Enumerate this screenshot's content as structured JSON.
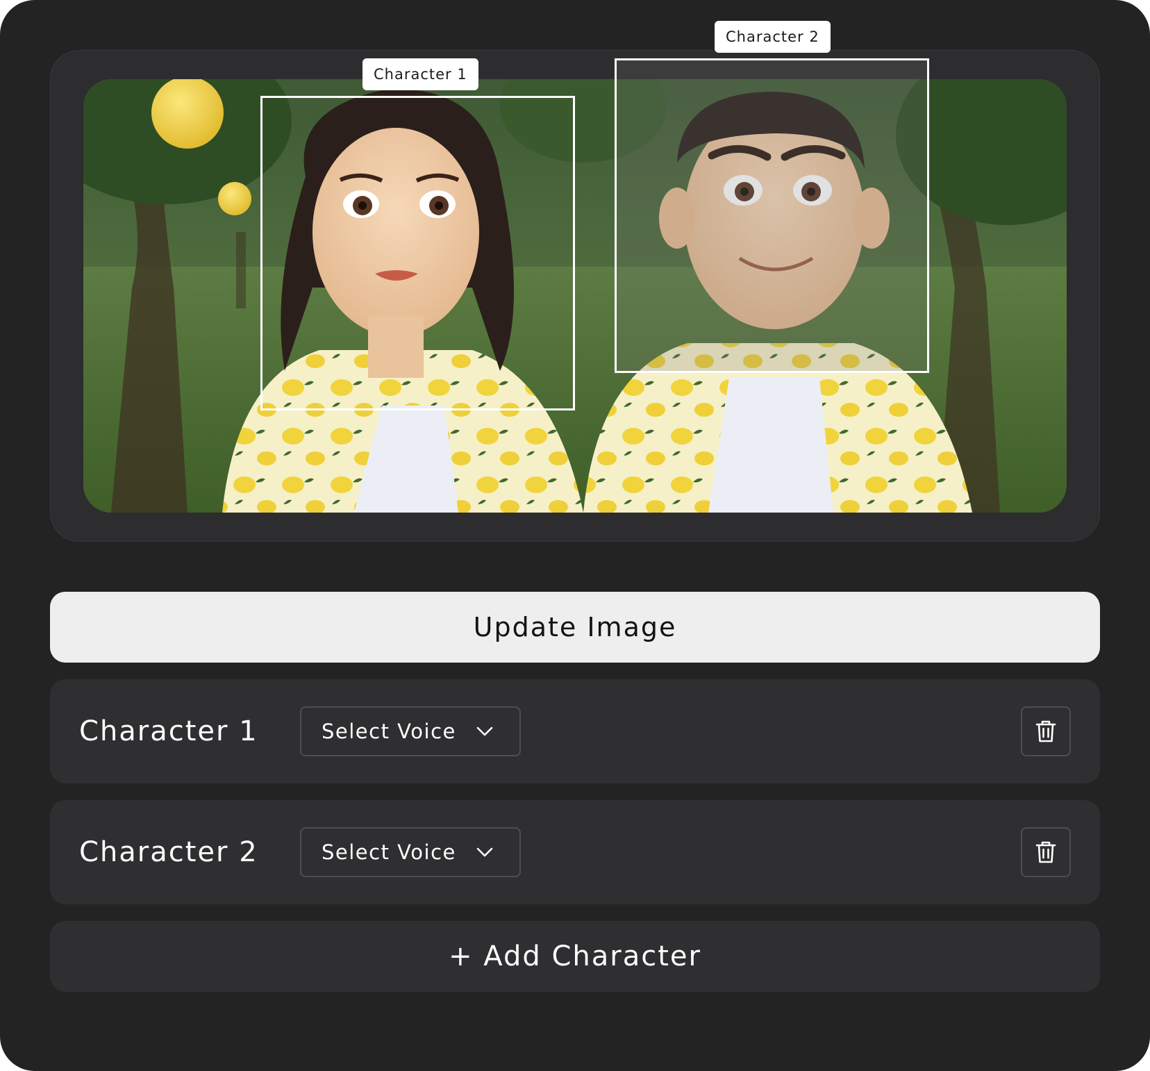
{
  "image": {
    "description_icon": "character-scene-image",
    "boxes": [
      {
        "label": "Character 1"
      },
      {
        "label": "Character 2"
      }
    ]
  },
  "actions": {
    "update_label": "Update Image",
    "add_label": "+ Add Character"
  },
  "characters": [
    {
      "name": "Character 1",
      "voice_placeholder": "Select Voice"
    },
    {
      "name": "Character 2",
      "voice_placeholder": "Select Voice"
    }
  ],
  "colors": {
    "app_background": "#242324",
    "panel": "#2d2c2e",
    "row": "#2f2e30",
    "primary_button": "#efeeef",
    "accent_lemon": "#f2d547"
  },
  "icons": {
    "dropdown": "chevron-down-icon",
    "delete": "trash-icon"
  }
}
